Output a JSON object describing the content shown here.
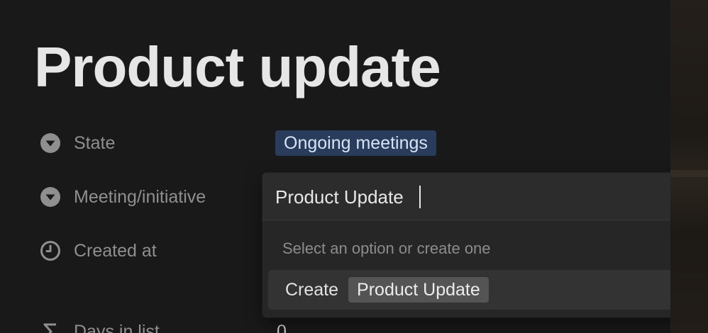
{
  "page": {
    "title": "Product update"
  },
  "properties": [
    {
      "label": "State",
      "icon": "caret-down-circle-icon"
    },
    {
      "label": "Meeting/initiative",
      "icon": "caret-down-circle-icon"
    },
    {
      "label": "Created at",
      "icon": "clock-icon"
    },
    {
      "label": "Days in list",
      "icon": "sigma-icon"
    }
  ],
  "state": {
    "value": "Ongoing meetings",
    "color": "#2a3c5c"
  },
  "days_in_list": {
    "value": "0"
  },
  "dropdown": {
    "input_value": "Product Update",
    "hint": "Select an option or create one",
    "create_label": "Create",
    "create_option": "Product Update"
  }
}
